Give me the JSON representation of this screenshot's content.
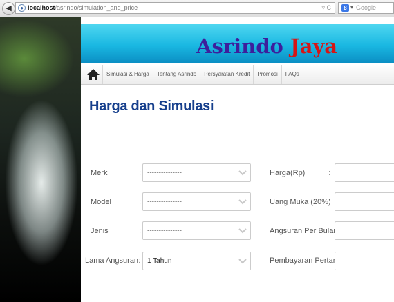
{
  "browser": {
    "url_host": "localhost",
    "url_path": "/asrindo/simulation_and_price",
    "search_engine": "Google"
  },
  "brand": {
    "part1": "Asrindo",
    "part2": "Jaya"
  },
  "nav": {
    "items": [
      "Simulasi & Harga",
      "Tentang Asrindo",
      "Persyaratan Kredit",
      "Promosi",
      "FAQs"
    ]
  },
  "page": {
    "title": "Harga dan Simulasi"
  },
  "form": {
    "left": [
      {
        "label": "Merk",
        "colon": ":",
        "value": "---------------"
      },
      {
        "label": "Model",
        "colon": ":",
        "value": "---------------"
      },
      {
        "label": "Jenis",
        "colon": ":",
        "value": "---------------"
      },
      {
        "label": "Lama Angsuran",
        "colon": ":",
        "value": "1 Tahun"
      }
    ],
    "right": [
      {
        "label": "Harga(Rp)",
        "colon": ":",
        "value": ""
      },
      {
        "label": "Uang Muka (20%)",
        "colon": ":",
        "value": ""
      },
      {
        "label": "Angsuran Per Bulan",
        "colon": ":",
        "value": ""
      },
      {
        "label": "Pembayaran Pertama",
        "colon": ":",
        "value": ""
      }
    ]
  },
  "colors": {
    "brand_primary": "#3d1f9c",
    "brand_accent": "#d61515",
    "title": "#163f8c",
    "banner": "#1ab8e2"
  }
}
